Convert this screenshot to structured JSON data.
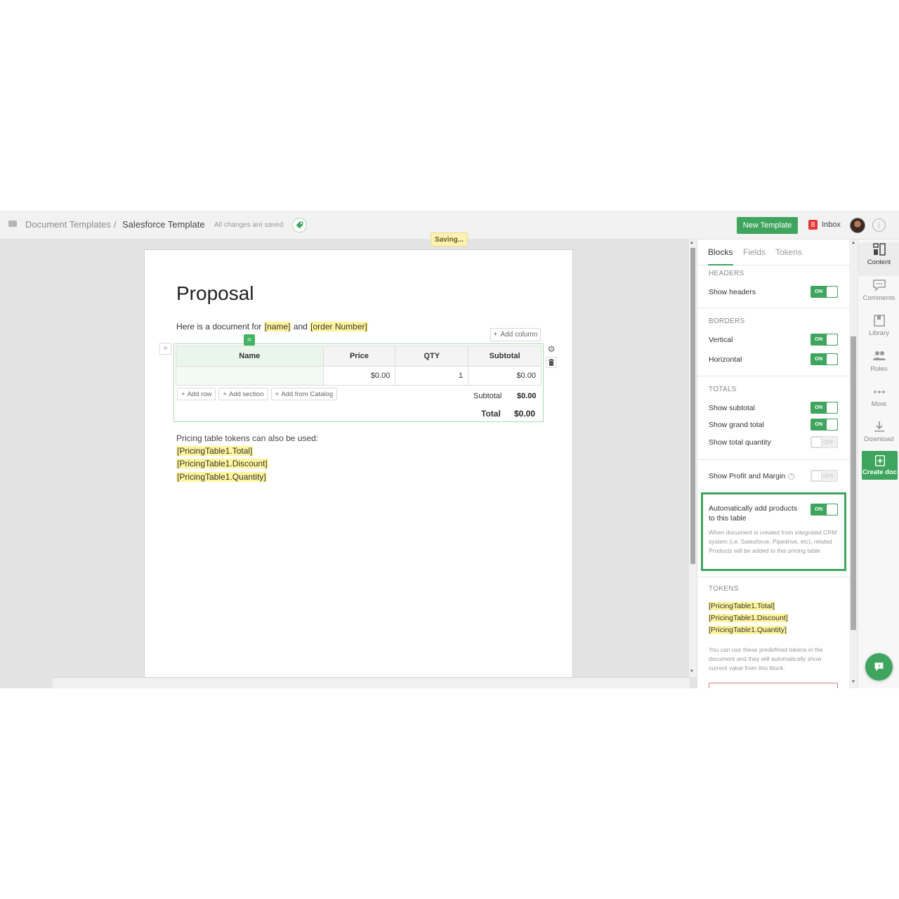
{
  "topbar": {
    "breadcrumb_root": "Document Templates",
    "breadcrumb_sep": "/",
    "breadcrumb_current": "Salesforce Template",
    "save_status": "All changes are saved",
    "saving_badge": "Saving...",
    "new_template_label": "New Template",
    "inbox_count": "8",
    "inbox_label": "Inbox",
    "info_glyph": "i"
  },
  "document": {
    "title": "Proposal",
    "intro_prefix": "Here is a document for",
    "intro_token_1": "[name]",
    "intro_and": "and",
    "intro_token_2": "[order Number]",
    "add_column_label": "Add column",
    "drag_glyph": "=",
    "pricing_table": {
      "columns": [
        "Name",
        "Price",
        "QTY",
        "Subtotal"
      ],
      "row": {
        "name": "",
        "price": "$0.00",
        "qty": "1",
        "subtotal": "$0.00"
      },
      "actions": [
        "Add row",
        "Add section",
        "Add from Catalog"
      ],
      "subtotal_label": "Subtotal",
      "subtotal_value": "$0.00",
      "total_label": "Total",
      "total_value": "$0.00"
    },
    "tokens_intro": "Pricing table tokens can also be used:",
    "tokens": [
      "[PricingTable1.Total]",
      "[PricingTable1.Discount]",
      "[PricingTable1.Quantity]"
    ]
  },
  "panel": {
    "tabs": [
      "Blocks",
      "Fields",
      "Tokens"
    ],
    "active_tab": "Blocks",
    "headers_section": "HEADERS",
    "show_headers_label": "Show headers",
    "borders_section": "BORDERS",
    "vertical_label": "Vertical",
    "horizontal_label": "Horizontal",
    "totals_section": "TOTALS",
    "show_subtotal_label": "Show subtotal",
    "show_grand_total_label": "Show grand total",
    "show_total_quantity_label": "Show total quantity",
    "show_profit_label": "Show Profit and Margin",
    "help_glyph": "?",
    "auto_add_line1": "Automatically add products",
    "auto_add_line2": "to this table",
    "auto_add_desc": "When document is created from integrated CRM system (i.e. Salesforce, Pipedrive, etc), related Products will be added to this pricing table",
    "tokens_section": "TOKENS",
    "tokens": [
      "[PricingTable1.Total]",
      "[PricingTable1.Discount]",
      "[PricingTable1.Quantity]"
    ],
    "tokens_desc": "You can use these predefined tokens in the document and they will automatically show current value from this block.",
    "on_text": "ON",
    "off_text": "OFF",
    "toggle_states": {
      "show_headers": true,
      "vertical": true,
      "horizontal": true,
      "show_subtotal": true,
      "show_grand_total": true,
      "show_total_quantity": false,
      "show_profit": false,
      "auto_add": true
    }
  },
  "rail": {
    "items": [
      "Content",
      "Comments",
      "Library",
      "Roles",
      "More",
      "Download"
    ],
    "create_doc": "Create doc",
    "active_item": "Content"
  },
  "colors": {
    "accent": "#3fa55e",
    "token_highlight": "#fff59d",
    "inbox_badge": "#e53935"
  }
}
